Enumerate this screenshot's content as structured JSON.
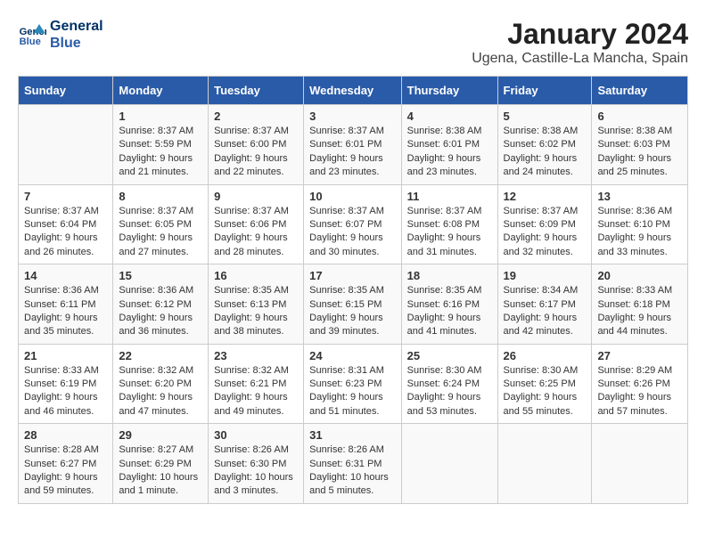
{
  "header": {
    "logo_line1": "General",
    "logo_line2": "Blue",
    "title": "January 2024",
    "subtitle": "Ugena, Castille-La Mancha, Spain"
  },
  "days_of_week": [
    "Sunday",
    "Monday",
    "Tuesday",
    "Wednesday",
    "Thursday",
    "Friday",
    "Saturday"
  ],
  "weeks": [
    [
      {
        "day": "",
        "info": ""
      },
      {
        "day": "1",
        "info": "Sunrise: 8:37 AM\nSunset: 5:59 PM\nDaylight: 9 hours\nand 21 minutes."
      },
      {
        "day": "2",
        "info": "Sunrise: 8:37 AM\nSunset: 6:00 PM\nDaylight: 9 hours\nand 22 minutes."
      },
      {
        "day": "3",
        "info": "Sunrise: 8:37 AM\nSunset: 6:01 PM\nDaylight: 9 hours\nand 23 minutes."
      },
      {
        "day": "4",
        "info": "Sunrise: 8:38 AM\nSunset: 6:01 PM\nDaylight: 9 hours\nand 23 minutes."
      },
      {
        "day": "5",
        "info": "Sunrise: 8:38 AM\nSunset: 6:02 PM\nDaylight: 9 hours\nand 24 minutes."
      },
      {
        "day": "6",
        "info": "Sunrise: 8:38 AM\nSunset: 6:03 PM\nDaylight: 9 hours\nand 25 minutes."
      }
    ],
    [
      {
        "day": "7",
        "info": "Sunrise: 8:37 AM\nSunset: 6:04 PM\nDaylight: 9 hours\nand 26 minutes."
      },
      {
        "day": "8",
        "info": "Sunrise: 8:37 AM\nSunset: 6:05 PM\nDaylight: 9 hours\nand 27 minutes."
      },
      {
        "day": "9",
        "info": "Sunrise: 8:37 AM\nSunset: 6:06 PM\nDaylight: 9 hours\nand 28 minutes."
      },
      {
        "day": "10",
        "info": "Sunrise: 8:37 AM\nSunset: 6:07 PM\nDaylight: 9 hours\nand 30 minutes."
      },
      {
        "day": "11",
        "info": "Sunrise: 8:37 AM\nSunset: 6:08 PM\nDaylight: 9 hours\nand 31 minutes."
      },
      {
        "day": "12",
        "info": "Sunrise: 8:37 AM\nSunset: 6:09 PM\nDaylight: 9 hours\nand 32 minutes."
      },
      {
        "day": "13",
        "info": "Sunrise: 8:36 AM\nSunset: 6:10 PM\nDaylight: 9 hours\nand 33 minutes."
      }
    ],
    [
      {
        "day": "14",
        "info": "Sunrise: 8:36 AM\nSunset: 6:11 PM\nDaylight: 9 hours\nand 35 minutes."
      },
      {
        "day": "15",
        "info": "Sunrise: 8:36 AM\nSunset: 6:12 PM\nDaylight: 9 hours\nand 36 minutes."
      },
      {
        "day": "16",
        "info": "Sunrise: 8:35 AM\nSunset: 6:13 PM\nDaylight: 9 hours\nand 38 minutes."
      },
      {
        "day": "17",
        "info": "Sunrise: 8:35 AM\nSunset: 6:15 PM\nDaylight: 9 hours\nand 39 minutes."
      },
      {
        "day": "18",
        "info": "Sunrise: 8:35 AM\nSunset: 6:16 PM\nDaylight: 9 hours\nand 41 minutes."
      },
      {
        "day": "19",
        "info": "Sunrise: 8:34 AM\nSunset: 6:17 PM\nDaylight: 9 hours\nand 42 minutes."
      },
      {
        "day": "20",
        "info": "Sunrise: 8:33 AM\nSunset: 6:18 PM\nDaylight: 9 hours\nand 44 minutes."
      }
    ],
    [
      {
        "day": "21",
        "info": "Sunrise: 8:33 AM\nSunset: 6:19 PM\nDaylight: 9 hours\nand 46 minutes."
      },
      {
        "day": "22",
        "info": "Sunrise: 8:32 AM\nSunset: 6:20 PM\nDaylight: 9 hours\nand 47 minutes."
      },
      {
        "day": "23",
        "info": "Sunrise: 8:32 AM\nSunset: 6:21 PM\nDaylight: 9 hours\nand 49 minutes."
      },
      {
        "day": "24",
        "info": "Sunrise: 8:31 AM\nSunset: 6:23 PM\nDaylight: 9 hours\nand 51 minutes."
      },
      {
        "day": "25",
        "info": "Sunrise: 8:30 AM\nSunset: 6:24 PM\nDaylight: 9 hours\nand 53 minutes."
      },
      {
        "day": "26",
        "info": "Sunrise: 8:30 AM\nSunset: 6:25 PM\nDaylight: 9 hours\nand 55 minutes."
      },
      {
        "day": "27",
        "info": "Sunrise: 8:29 AM\nSunset: 6:26 PM\nDaylight: 9 hours\nand 57 minutes."
      }
    ],
    [
      {
        "day": "28",
        "info": "Sunrise: 8:28 AM\nSunset: 6:27 PM\nDaylight: 9 hours\nand 59 minutes."
      },
      {
        "day": "29",
        "info": "Sunrise: 8:27 AM\nSunset: 6:29 PM\nDaylight: 10 hours\nand 1 minute."
      },
      {
        "day": "30",
        "info": "Sunrise: 8:26 AM\nSunset: 6:30 PM\nDaylight: 10 hours\nand 3 minutes."
      },
      {
        "day": "31",
        "info": "Sunrise: 8:26 AM\nSunset: 6:31 PM\nDaylight: 10 hours\nand 5 minutes."
      },
      {
        "day": "",
        "info": ""
      },
      {
        "day": "",
        "info": ""
      },
      {
        "day": "",
        "info": ""
      }
    ]
  ]
}
